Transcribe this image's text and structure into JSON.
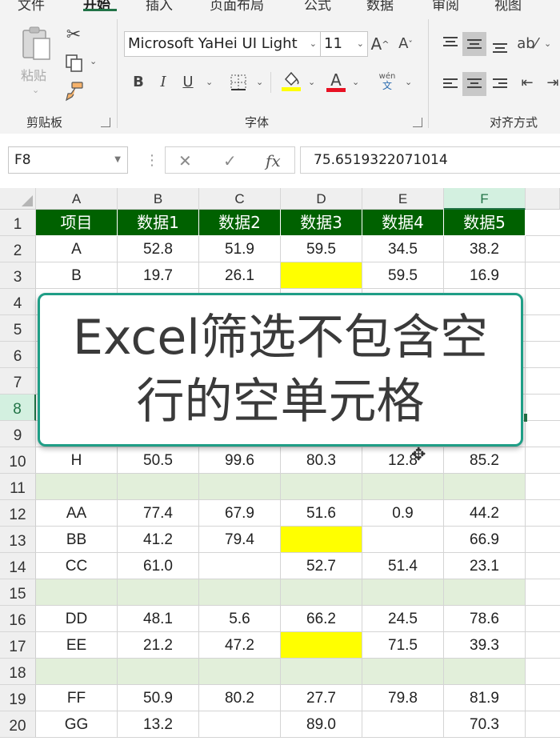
{
  "ribbon": {
    "tabs": [
      "文件",
      "开始",
      "插入",
      "页面布局",
      "公式",
      "数据",
      "审阅",
      "视图"
    ],
    "clipboard": {
      "paste_label": "粘贴",
      "group_label": "剪贴板"
    },
    "font": {
      "name": "Microsoft YaHei UI Light",
      "size": "11",
      "group_label": "字体",
      "bold": "B",
      "italic": "I",
      "underline": "U",
      "font_color_glyph": "A",
      "phonetic_top": "wén",
      "phonetic_bottom": "文"
    },
    "alignment": {
      "group_label": "对齐方式"
    },
    "colors": {
      "highlight": "#ffff00",
      "font_color": "#e81123"
    }
  },
  "formula_bar": {
    "name_box": "F8",
    "value": "75.6519322071014",
    "fx": "fx",
    "cancel": "✕",
    "enter": "✓"
  },
  "sheet": {
    "columns": [
      "A",
      "B",
      "C",
      "D",
      "E",
      "F"
    ],
    "selected_column": "F",
    "selected_row": "8",
    "rows": [
      {
        "num": "1",
        "cells": [
          "项目",
          "数据1",
          "数据2",
          "数据3",
          "数据4",
          "数据5"
        ]
      },
      {
        "num": "2",
        "cells": [
          "A",
          "52.8",
          "51.9",
          "59.5",
          "34.5",
          "38.2"
        ]
      },
      {
        "num": "3",
        "cells": [
          "B",
          "19.7",
          "26.1",
          "",
          "59.5",
          "16.9"
        ]
      },
      {
        "num": "4",
        "cells": [
          "",
          "",
          "",
          "",
          "",
          ""
        ]
      },
      {
        "num": "5",
        "cells": [
          "",
          "",
          "",
          "",
          "",
          ""
        ]
      },
      {
        "num": "6",
        "cells": [
          "",
          "",
          "",
          "",
          "",
          ""
        ]
      },
      {
        "num": "7",
        "cells": [
          "",
          "",
          "",
          "",
          "",
          ""
        ]
      },
      {
        "num": "8",
        "cells": [
          "",
          "",
          "",
          "",
          "",
          ""
        ]
      },
      {
        "num": "9",
        "cells": [
          "",
          "",
          "",
          "",
          "",
          ""
        ]
      },
      {
        "num": "10",
        "cells": [
          "H",
          "50.5",
          "99.6",
          "80.3",
          "12.8",
          "85.2"
        ]
      },
      {
        "num": "11",
        "cells": [
          "",
          "",
          "",
          "",
          "",
          ""
        ]
      },
      {
        "num": "12",
        "cells": [
          "AA",
          "77.4",
          "67.9",
          "51.6",
          "0.9",
          "44.2"
        ]
      },
      {
        "num": "13",
        "cells": [
          "BB",
          "41.2",
          "79.4",
          "",
          "",
          "66.9"
        ]
      },
      {
        "num": "14",
        "cells": [
          "CC",
          "61.0",
          "",
          "52.7",
          "51.4",
          "23.1"
        ]
      },
      {
        "num": "15",
        "cells": [
          "",
          "",
          "",
          "",
          "",
          ""
        ]
      },
      {
        "num": "16",
        "cells": [
          "DD",
          "48.1",
          "5.6",
          "66.2",
          "24.5",
          "78.6"
        ]
      },
      {
        "num": "17",
        "cells": [
          "EE",
          "21.2",
          "47.2",
          "",
          "71.5",
          "39.3"
        ]
      },
      {
        "num": "18",
        "cells": [
          "",
          "",
          "",
          "",
          "",
          ""
        ]
      },
      {
        "num": "19",
        "cells": [
          "FF",
          "50.9",
          "80.2",
          "27.7",
          "79.8",
          "81.9"
        ]
      },
      {
        "num": "20",
        "cells": [
          "GG",
          "13.2",
          "",
          "89.0",
          "",
          "70.3"
        ]
      }
    ],
    "highlight_cells": [
      "D3",
      "D13",
      "D17"
    ],
    "band_rows": [
      "11",
      "15",
      "18"
    ],
    "header_fill": "#006100",
    "highlight_fill": "#ffff00",
    "band_fill": "#e2efda"
  },
  "overlay": {
    "line1": "Excel筛选不包含空",
    "line2": "行的空单元格"
  }
}
